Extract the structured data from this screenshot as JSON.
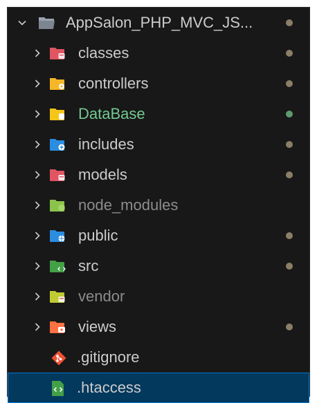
{
  "explorer": {
    "root": {
      "label": "AppSalon_PHP_MVC_JS...",
      "dot_color": "#8a7e66"
    },
    "items": [
      {
        "label": "classes",
        "icon": "classes-folder-icon",
        "color": "#e05561",
        "badge": "box",
        "dot_color": "#8a7e66",
        "style": "normal"
      },
      {
        "label": "controllers",
        "icon": "controllers-folder-icon",
        "color": "#f5b727",
        "badge": "gear",
        "dot_color": "#8a7e66",
        "style": "normal"
      },
      {
        "label": "DataBase",
        "icon": "database-folder-icon",
        "color": "#f5c518",
        "badge": "db",
        "dot_color": "#5f9a6e",
        "style": "green"
      },
      {
        "label": "includes",
        "icon": "includes-folder-icon",
        "color": "#2b8de0",
        "badge": "plus",
        "dot_color": "#8a7e66",
        "style": "normal"
      },
      {
        "label": "models",
        "icon": "models-folder-icon",
        "color": "#e05561",
        "badge": "box",
        "dot_color": "#8a7e66",
        "style": "normal"
      },
      {
        "label": "node_modules",
        "icon": "node-modules-folder-icon",
        "color": "#8bc34a",
        "badge": "hex",
        "dot_color": "",
        "style": "dim"
      },
      {
        "label": "public",
        "icon": "public-folder-icon",
        "color": "#2b8de0",
        "badge": "globe",
        "dot_color": "#8a7e66",
        "style": "normal"
      },
      {
        "label": "src",
        "icon": "src-folder-icon",
        "color": "#43a047",
        "badge": "code",
        "dot_color": "#8a7e66",
        "style": "normal"
      },
      {
        "label": "vendor",
        "icon": "vendor-folder-icon",
        "color": "#c0ca33",
        "badge": "box",
        "dot_color": "",
        "style": "dim"
      },
      {
        "label": "views",
        "icon": "views-folder-icon",
        "color": "#ff7043",
        "badge": "eye",
        "dot_color": "#8a7e66",
        "style": "normal"
      }
    ],
    "files": [
      {
        "label": ".gitignore",
        "icon": "git-icon",
        "color": "#f05133",
        "selected": false
      },
      {
        "label": ".htaccess",
        "icon": "htaccess-file-icon",
        "color": "#43a047",
        "selected": true
      }
    ]
  }
}
